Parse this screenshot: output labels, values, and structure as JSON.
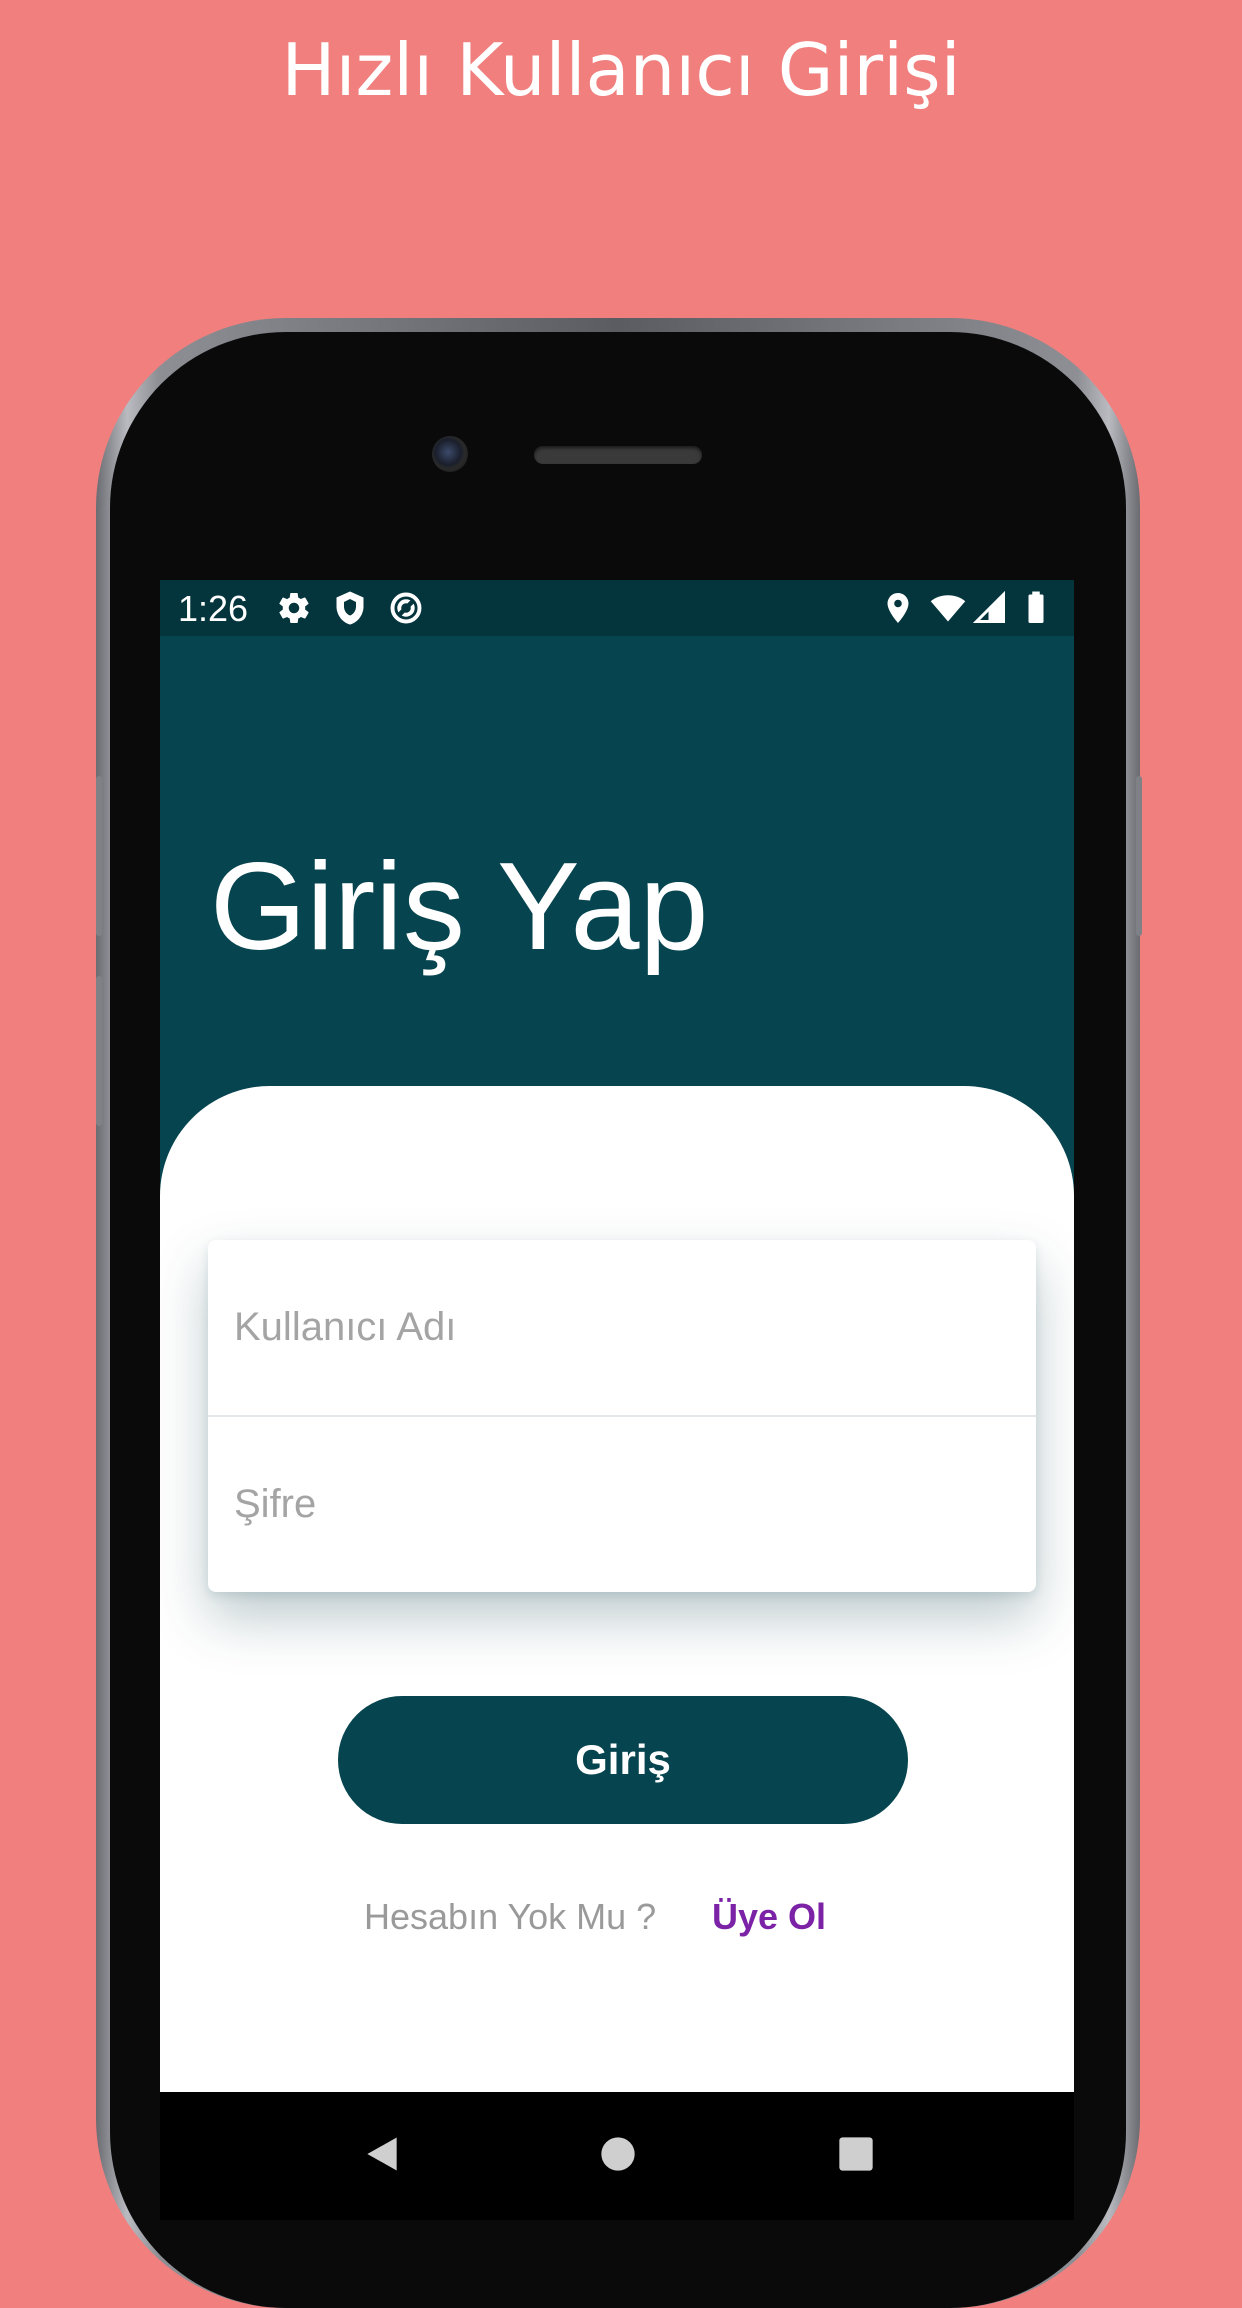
{
  "promo": {
    "title": "Hızlı Kullanıcı Girişi"
  },
  "status_bar": {
    "time": "1:26",
    "left_icons": [
      "gear-icon",
      "shield-icon",
      "sync-icon"
    ],
    "right_icons": [
      "location-icon",
      "wifi-icon",
      "signal-icon",
      "battery-icon"
    ]
  },
  "screen": {
    "title": "Giriş Yap",
    "username": {
      "placeholder": "Kullanıcı Adı",
      "value": ""
    },
    "password": {
      "placeholder": "Şifre",
      "value": ""
    },
    "login_button": "Giriş",
    "signup_prompt": "Hesabın Yok Mu ?",
    "signup_link": "Üye Ol"
  },
  "nav_bar": {
    "icons": [
      "back-icon",
      "home-icon",
      "recents-icon"
    ]
  },
  "colors": {
    "background": "#f07f7e",
    "primary": "#06454f",
    "status_bar": "#04353c",
    "link": "#7b22a6"
  }
}
